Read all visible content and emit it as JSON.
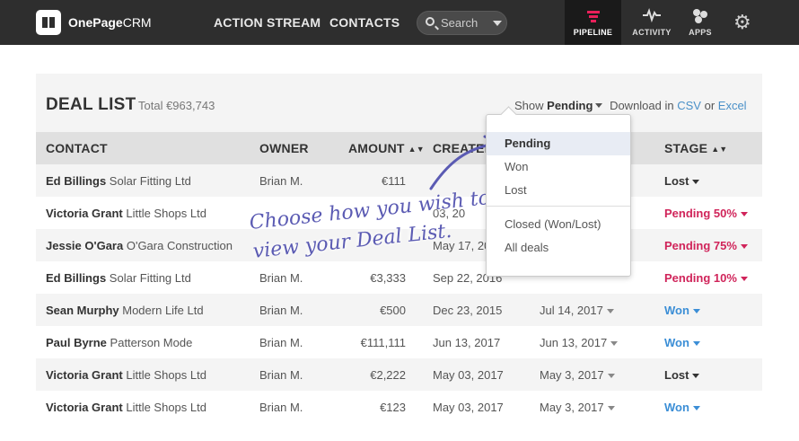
{
  "nav": {
    "brand_bold": "OnePage",
    "brand_light": "CRM",
    "links": [
      "ACTION STREAM",
      "CONTACTS"
    ],
    "search_placeholder": "Search",
    "pipeline_label": "PIPELINE",
    "activity_label": "ACTIVITY",
    "apps_label": "APPS",
    "accent_color": "#e8205a"
  },
  "panel": {
    "title": "DEAL LIST",
    "total": "Total €963,743",
    "show_label": "Show",
    "show_value": "Pending",
    "download_label": "Download in",
    "csv_label": "CSV",
    "or_label": "or",
    "excel_label": "Excel"
  },
  "table": {
    "headers": [
      "CONTACT",
      "OWNER",
      "AMOUNT",
      "CREATED",
      "STAGE"
    ],
    "rows": [
      {
        "name": "Ed Billings",
        "company": "Solar Fitting Ltd",
        "owner": "Brian M.",
        "amount": "€111",
        "created": "",
        "close": "",
        "stage": "Lost",
        "stage_color": "#333333"
      },
      {
        "name": "Victoria Grant",
        "company": "Little Shops Ltd",
        "owner": "",
        "amount": "",
        "created": "03, 20",
        "close": "",
        "stage": "Pending 50%",
        "stage_color": "#d0245a"
      },
      {
        "name": "Jessie O'Gara",
        "company": "O'Gara Construction",
        "owner": "",
        "amount": "",
        "created": "May 17, 20",
        "close": "",
        "stage": "Pending 75%",
        "stage_color": "#d0245a"
      },
      {
        "name": "Ed Billings",
        "company": "Solar Fitting Ltd",
        "owner": "Brian M.",
        "amount": "€3,333",
        "created": "Sep 22, 2016",
        "close": "",
        "stage": "Pending 10%",
        "stage_color": "#d0245a"
      },
      {
        "name": "Sean Murphy",
        "company": "Modern Life Ltd",
        "owner": "Brian M.",
        "amount": "€500",
        "created": "Dec 23, 2015",
        "close": "Jul 14, 2017",
        "stage": "Won",
        "stage_color": "#3b8ed6"
      },
      {
        "name": "Paul Byrne",
        "company": "Patterson Mode",
        "owner": "Brian M.",
        "amount": "€111,111",
        "created": "Jun 13, 2017",
        "close": "Jun 13, 2017",
        "stage": "Won",
        "stage_color": "#3b8ed6"
      },
      {
        "name": "Victoria Grant",
        "company": "Little Shops Ltd",
        "owner": "Brian M.",
        "amount": "€2,222",
        "created": "May 03, 2017",
        "close": "May 3, 2017",
        "stage": "Lost",
        "stage_color": "#333333"
      },
      {
        "name": "Victoria Grant",
        "company": "Little Shops Ltd",
        "owner": "Brian M.",
        "amount": "€123",
        "created": "May 03, 2017",
        "close": "May 3, 2017",
        "stage": "Won",
        "stage_color": "#3b8ed6"
      }
    ]
  },
  "dropdown": {
    "items": [
      "Pending",
      "Won",
      "Lost",
      "Closed (Won/Lost)",
      "All deals"
    ],
    "active": "Pending"
  },
  "annotation": {
    "line1": "Choose how you wish to",
    "line2": "view your Deal List."
  }
}
